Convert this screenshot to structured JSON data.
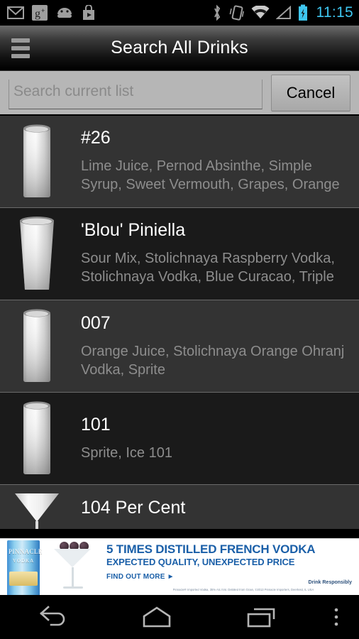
{
  "status_bar": {
    "icons": [
      "gmail-icon",
      "google-plus-icon",
      "android-icon",
      "play-store-icon"
    ],
    "right_icons": [
      "bluetooth-icon",
      "vibrate-icon",
      "wifi-icon",
      "cell-signal-icon",
      "battery-charging-icon"
    ],
    "time": "11:15",
    "accent_color": "#3ec6f0"
  },
  "action_bar": {
    "title": "Search All Drinks",
    "menu_icon": "hamburger-menu-icon"
  },
  "search": {
    "placeholder": "Search current list",
    "value": "",
    "cancel_label": "Cancel"
  },
  "list": {
    "items": [
      {
        "name": "#26",
        "ingredients": "Lime Juice, Pernod Absinthe, Simple Syrup, Sweet Vermouth, Grapes, Orange Juice",
        "glass": "collins-glass-icon"
      },
      {
        "name": "'Blou' Piniella",
        "ingredients": "Sour Mix, Stolichnaya Raspberry Vodka, Stolichnaya Vodka, Blue Curacao, Triple Se…",
        "glass": "pint-glass-icon"
      },
      {
        "name": "007",
        "ingredients": "Orange Juice, Stolichnaya Orange Ohranj Vodka, Sprite",
        "glass": "collins-glass-icon"
      },
      {
        "name": "101",
        "ingredients": "Sprite, Ice 101",
        "glass": "collins-glass-icon"
      },
      {
        "name": "104 Per Cent",
        "ingredients": "",
        "glass": "martini-glass-icon"
      }
    ]
  },
  "ad": {
    "headline": "5 TIMES DISTILLED FRENCH VODKA",
    "subhead": "EXPECTED QUALITY, UNEXPECTED PRICE",
    "cta": "FIND OUT MORE ►",
    "responsibly": "Drink Responsibly",
    "legal": "Pinnacle® Imported Vodka, 35% Alc./Vol. Distilled from Grain, ©2013 Pinnacle Importers, Deerfield, IL USA",
    "brand": "PINNACLE",
    "brand_sub": "VODKA",
    "brand_color": "#1a5fa8"
  },
  "nav_bar": {
    "buttons": [
      "back-icon",
      "home-icon",
      "recents-icon",
      "overflow-menu-icon"
    ]
  }
}
